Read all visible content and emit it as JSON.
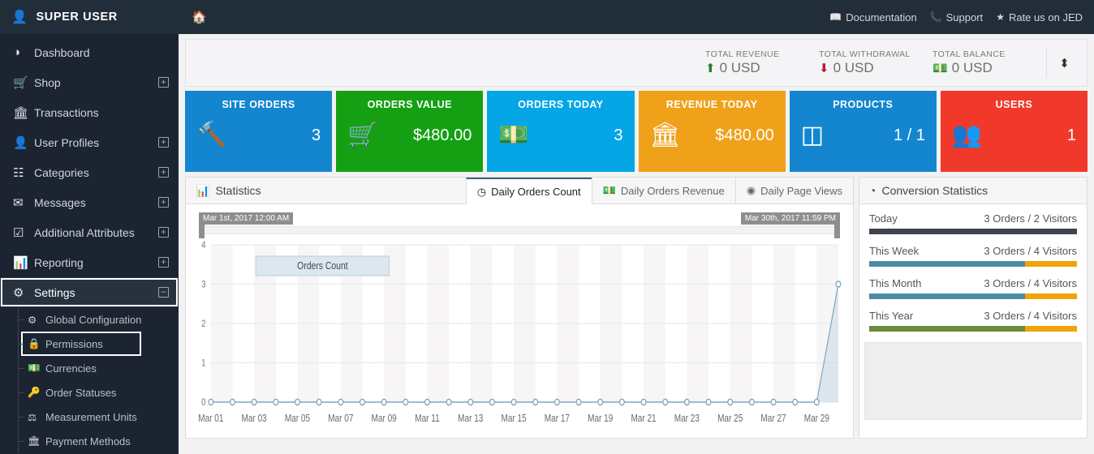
{
  "sidebar": {
    "brand": "SUPER USER",
    "brand_icon": "user-icon",
    "items": [
      {
        "label": "Dashboard",
        "icon": "speedometer-icon",
        "expandable": false
      },
      {
        "label": "Shop",
        "icon": "cart-icon",
        "expandable": true
      },
      {
        "label": "Transactions",
        "icon": "bank-icon",
        "expandable": false
      },
      {
        "label": "User Profiles",
        "icon": "user-icon",
        "expandable": true
      },
      {
        "label": "Categories",
        "icon": "sitemap-icon",
        "expandable": true
      },
      {
        "label": "Messages",
        "icon": "envelope-icon",
        "expandable": true
      },
      {
        "label": "Additional Attributes",
        "icon": "checkbox-icon",
        "expandable": true
      },
      {
        "label": "Reporting",
        "icon": "bar-chart-icon",
        "expandable": true
      },
      {
        "label": "Settings",
        "icon": "gear-icon",
        "expandable": true,
        "active": true,
        "collapse_sign": "⊖"
      }
    ],
    "settings_submenu": [
      {
        "label": "Global Configuration",
        "icon": "gears-icon"
      },
      {
        "label": "Permissions",
        "icon": "lock-icon",
        "boxed": true
      },
      {
        "label": "Currencies",
        "icon": "money-icon"
      },
      {
        "label": "Order Statuses",
        "icon": "key-icon"
      },
      {
        "label": "Measurement Units",
        "icon": "balance-scale-icon"
      },
      {
        "label": "Payment Methods",
        "icon": "bank-icon"
      }
    ]
  },
  "topbar": {
    "home_icon": "home-icon",
    "links": [
      {
        "label": "Documentation",
        "icon": "book-icon"
      },
      {
        "label": "Support",
        "icon": "phone-icon"
      },
      {
        "label": "Rate us on JED",
        "icon": "star-icon"
      }
    ]
  },
  "totals": {
    "items": [
      {
        "label": "TOTAL REVENUE",
        "value": "0 USD",
        "icon": "arrow-up-circle-icon",
        "color": "#2c7a2c"
      },
      {
        "label": "TOTAL WITHDRAWAL",
        "value": "0 USD",
        "icon": "arrow-down-circle-icon",
        "color": "#b91b3a"
      },
      {
        "label": "TOTAL BALANCE",
        "value": "0 USD",
        "icon": "money-icon",
        "color": "#3b8fc7"
      }
    ],
    "sorter_icon": "sort-updown-icon"
  },
  "tiles": [
    {
      "title": "SITE ORDERS",
      "value": "3",
      "icon": "gavel-icon",
      "color": "#1486d0"
    },
    {
      "title": "ORDERS VALUE",
      "value": "$480.00",
      "icon": "cart-arrow-down-icon",
      "color": "#15a014"
    },
    {
      "title": "ORDERS TODAY",
      "value": "3",
      "icon": "money-bill-icon",
      "color": "#04a6e6"
    },
    {
      "title": "REVENUE TODAY",
      "value": "$480.00",
      "icon": "bank-icon",
      "color": "#efa11a"
    },
    {
      "title": "PRODUCTS",
      "value": "1 / 1",
      "icon": "cubes-icon",
      "color": "#1486d0"
    },
    {
      "title": "USERS",
      "value": "1",
      "icon": "users-icon",
      "color": "#f0392b"
    }
  ],
  "statistics": {
    "panel_title": "Statistics",
    "panel_icon": "bar-chart-icon",
    "tabs": [
      {
        "label": "Daily Orders Count",
        "icon": "clock-icon",
        "active": true
      },
      {
        "label": "Daily Orders Revenue",
        "icon": "money-icon",
        "active": false
      },
      {
        "label": "Daily Page Views",
        "icon": "eye-icon",
        "active": false
      }
    ],
    "range_start": "Mar 1st, 2017 12:00 AM",
    "range_end": "Mar 30th, 2017 11:59 PM"
  },
  "chart_data": {
    "type": "line",
    "title": "",
    "legend": [
      "Orders Count"
    ],
    "legend_position": "top-left-inside",
    "xlabel": "",
    "ylabel": "",
    "ylim": [
      0,
      4
    ],
    "yticks": [
      0,
      1,
      2,
      3,
      4
    ],
    "grid": true,
    "x": [
      "Mar 01",
      "Mar 02",
      "Mar 03",
      "Mar 04",
      "Mar 05",
      "Mar 06",
      "Mar 07",
      "Mar 08",
      "Mar 09",
      "Mar 10",
      "Mar 11",
      "Mar 12",
      "Mar 13",
      "Mar 14",
      "Mar 15",
      "Mar 16",
      "Mar 17",
      "Mar 18",
      "Mar 19",
      "Mar 20",
      "Mar 21",
      "Mar 22",
      "Mar 23",
      "Mar 24",
      "Mar 25",
      "Mar 26",
      "Mar 27",
      "Mar 28",
      "Mar 29",
      "Mar 30"
    ],
    "xticklabels": [
      "Mar 01",
      "Mar 03",
      "Mar 05",
      "Mar 07",
      "Mar 09",
      "Mar 11",
      "Mar 13",
      "Mar 15",
      "Mar 17",
      "Mar 19",
      "Mar 21",
      "Mar 23",
      "Mar 25",
      "Mar 27",
      "Mar 29"
    ],
    "series": [
      {
        "name": "Orders Count",
        "color": "#7da7c4",
        "fill": "#c9d9e6",
        "values": [
          0,
          0,
          0,
          0,
          0,
          0,
          0,
          0,
          0,
          0,
          0,
          0,
          0,
          0,
          0,
          0,
          0,
          0,
          0,
          0,
          0,
          0,
          0,
          0,
          0,
          0,
          0,
          0,
          0,
          3
        ]
      }
    ]
  },
  "conversion": {
    "title": "Conversion Statistics",
    "icon": "pie-chart-icon",
    "rows": [
      {
        "label": "Today",
        "value": "3 Orders / 2 Visitors",
        "primary_color": "#3f444c",
        "secondary_color": "#3f444c",
        "primary_pct": 100
      },
      {
        "label": "This Week",
        "value": "3 Orders / 4 Visitors",
        "primary_color": "#4a8ca6",
        "secondary_color": "#f0a30a",
        "primary_pct": 75
      },
      {
        "label": "This Month",
        "value": "3 Orders / 4 Visitors",
        "primary_color": "#4a8ca6",
        "secondary_color": "#f0a30a",
        "primary_pct": 75
      },
      {
        "label": "This Year",
        "value": "3 Orders / 4 Visitors",
        "primary_color": "#6b8b3d",
        "secondary_color": "#f0a30a",
        "primary_pct": 75
      }
    ]
  }
}
